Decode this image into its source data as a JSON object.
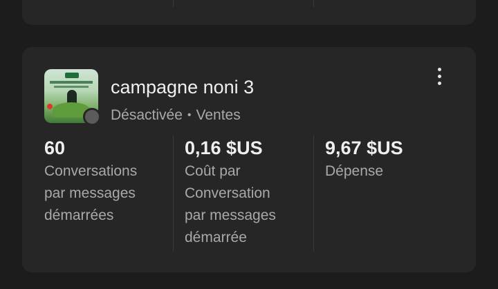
{
  "campaign": {
    "name": "campagne noni 3",
    "status": "Désactivée",
    "separator": "•",
    "objective": "Ventes"
  },
  "icons": {
    "thumbnail": "campaign-ad-thumbnail",
    "status": "inactive-status-dot",
    "menu": "more-vertical-icon"
  },
  "colors": {
    "background": "#1c1c1c",
    "card": "#262626",
    "text_primary": "#efefef",
    "text_secondary": "#a9a9a9"
  },
  "metrics": [
    {
      "value": "60",
      "label_lines": [
        "Conversations",
        "par messages",
        "démarrées"
      ]
    },
    {
      "value": "0,16 $US",
      "label_lines": [
        "Coût par",
        "Conversation",
        "par messages",
        "démarrée"
      ]
    },
    {
      "value": "9,67 $US",
      "label_lines": [
        "Dépense"
      ]
    }
  ]
}
